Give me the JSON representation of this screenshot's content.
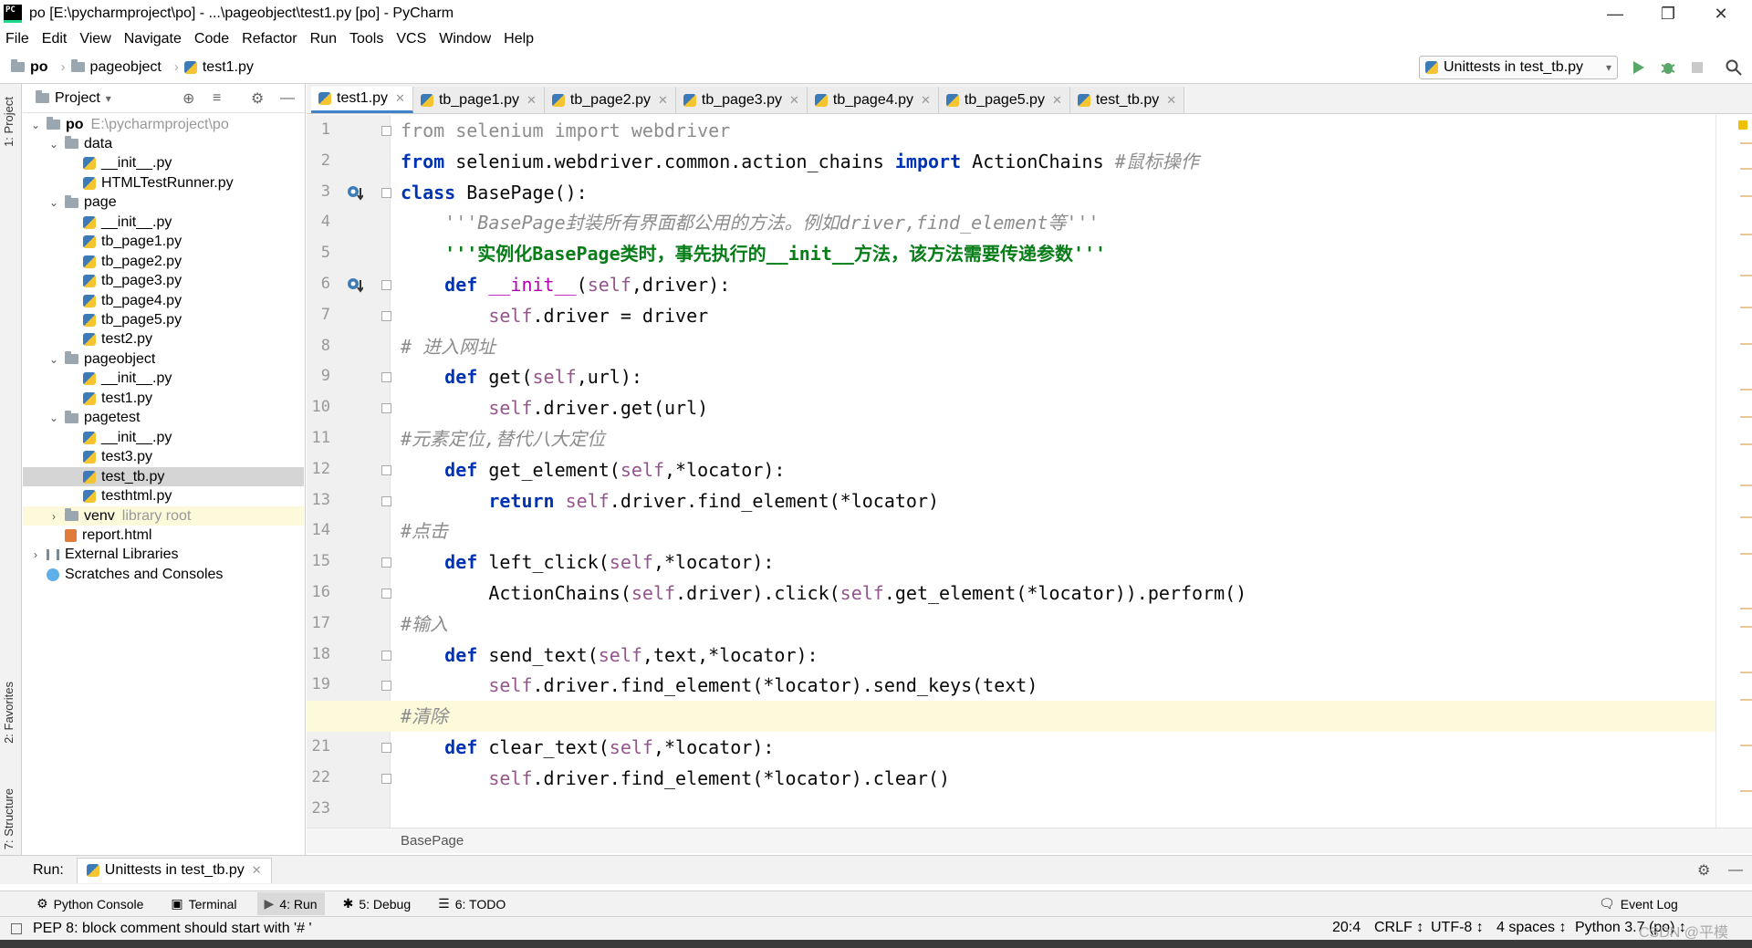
{
  "window": {
    "title": "po [E:\\pycharmproject\\po] - ...\\pageobject\\test1.py [po] - PyCharm",
    "icon_text": "PC"
  },
  "menu": [
    "File",
    "Edit",
    "View",
    "Navigate",
    "Code",
    "Refactor",
    "Run",
    "Tools",
    "VCS",
    "Window",
    "Help"
  ],
  "breadcrumbs": [
    "po",
    "pageobject",
    "test1.py"
  ],
  "run_config": "Unittests in test_tb.py",
  "left_stripe": {
    "project": "1: Project",
    "favorites": "2: Favorites",
    "structure": "7: Structure"
  },
  "project": {
    "header": "Project",
    "tree": [
      {
        "label": "po",
        "path": "E:\\pycharmproject\\po",
        "kind": "folder",
        "expanded": true
      },
      {
        "label": "data",
        "kind": "folder",
        "expanded": true
      },
      {
        "label": "__init__.py",
        "kind": "file"
      },
      {
        "label": "HTMLTestRunner.py",
        "kind": "file"
      },
      {
        "label": "page",
        "kind": "folder",
        "expanded": true
      },
      {
        "label": "__init__.py",
        "kind": "file"
      },
      {
        "label": "tb_page1.py",
        "kind": "file"
      },
      {
        "label": "tb_page2.py",
        "kind": "file"
      },
      {
        "label": "tb_page3.py",
        "kind": "file"
      },
      {
        "label": "tb_page4.py",
        "kind": "file"
      },
      {
        "label": "tb_page5.py",
        "kind": "file"
      },
      {
        "label": "test2.py",
        "kind": "file"
      },
      {
        "label": "pageobject",
        "kind": "folder",
        "expanded": true
      },
      {
        "label": "__init__.py",
        "kind": "file"
      },
      {
        "label": "test1.py",
        "kind": "file"
      },
      {
        "label": "pagetest",
        "kind": "folder",
        "expanded": true
      },
      {
        "label": "__init__.py",
        "kind": "file"
      },
      {
        "label": "test3.py",
        "kind": "file"
      },
      {
        "label": "test_tb.py",
        "kind": "file",
        "selected": true
      },
      {
        "label": "testhtml.py",
        "kind": "file"
      },
      {
        "label": "venv",
        "note": "library root",
        "kind": "folder",
        "expanded": false
      },
      {
        "label": "report.html",
        "kind": "file"
      },
      {
        "label": "External Libraries",
        "kind": "lib",
        "expanded": false
      },
      {
        "label": "Scratches and Consoles",
        "kind": "scratch"
      }
    ]
  },
  "tabs": [
    "test1.py",
    "tb_page1.py",
    "tb_page2.py",
    "tb_page3.py",
    "tb_page4.py",
    "tb_page5.py",
    "test_tb.py"
  ],
  "active_tab": "test1.py",
  "code_lines": [
    "from selenium import webdriver",
    "from selenium.webdriver.common.action_chains import ActionChains #鼠标操作",
    "class BasePage():",
    "    '''BasePage封装所有界面都公用的方法。例如driver,find_element等'''",
    "    '''实例化BasePage类时，事先执行的__init__方法，该方法需要传递参数'''",
    "    def __init__(self,driver):",
    "        self.driver = driver",
    "# 进入网址",
    "    def get(self,url):",
    "        self.driver.get(url)",
    "#元素定位,替代八大定位",
    "    def get_element(self,*locator):",
    "        return self.driver.find_element(*locator)",
    "#点击",
    "    def left_click(self,*locator):",
    "        ActionChains(self.driver).click(self.get_element(*locator)).perform()",
    "#输入",
    "    def send_text(self,text,*locator):",
    "        self.driver.find_element(*locator).send_keys(text)",
    "#清除",
    "    def clear_text(self,*locator):",
    "        self.driver.find_element(*locator).clear()",
    ""
  ],
  "current_line": 20,
  "editor_breadcrumb": "BasePage",
  "run_panel": {
    "label": "Run:",
    "tab": "Unittests in test_tb.py"
  },
  "bottom_tabs": [
    "Python Console",
    "Terminal",
    "4: Run",
    "5: Debug",
    "6: TODO"
  ],
  "event_log": "Event Log",
  "status": {
    "message": "PEP 8: block comment should start with '# '",
    "position": "20:4",
    "line_sep": "CRLF ↕",
    "encoding": "UTF-8 ↕",
    "indent": "4 spaces ↕",
    "interpreter": "Python 3.7 (po) ↕",
    "watermark": "CSDN @平模"
  }
}
